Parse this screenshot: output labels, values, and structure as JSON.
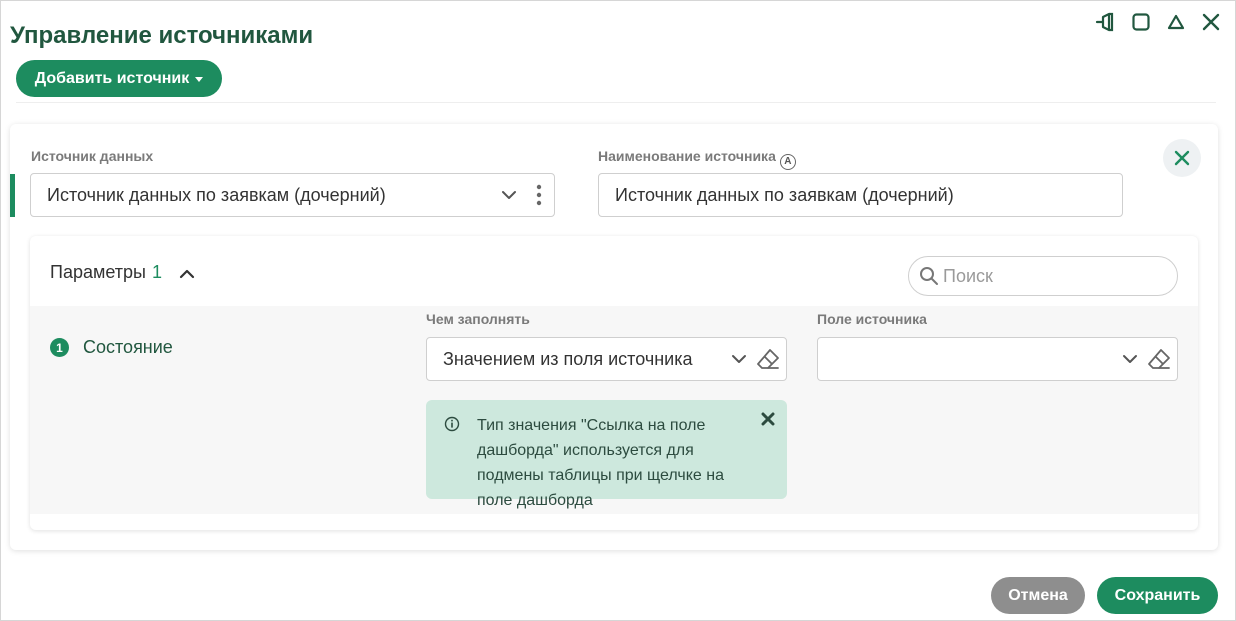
{
  "header": {
    "title": "Управление источниками",
    "add_button_label": "Добавить источник"
  },
  "source": {
    "data_source_label": "Источник данных",
    "data_source_value": "Источник данных по заявкам (дочерний)",
    "name_label": "Наименование источника",
    "name_badge": "A",
    "name_value": "Источник данных по заявкам (дочерний)"
  },
  "params": {
    "title": "Параметры",
    "count": "1",
    "search_placeholder": "Поиск",
    "fill_with_label": "Чем заполнять",
    "source_field_label": "Поле источника",
    "row": {
      "number": "1",
      "name": "Состояние",
      "fill_with_value": "Значением из поля источника",
      "source_field_value": ""
    },
    "hint_text": "Тип значения \"Ссылка на поле дашборда\" используется для подмены таблицы при щелчке на поле дашборда"
  },
  "footer": {
    "cancel_label": "Отмена",
    "save_label": "Сохранить"
  },
  "colors": {
    "accent": "#1d8c5f",
    "title": "#21573f",
    "hint_bg": "#cde8dd",
    "cancel_bg": "#8e8e8e"
  },
  "icons": [
    "pin-icon",
    "maximize-icon",
    "collapse-icon",
    "close-icon",
    "caret-down-icon",
    "chevron-down-icon",
    "kebab-icon",
    "search-icon",
    "chevron-up-icon",
    "eraser-icon",
    "info-icon"
  ]
}
